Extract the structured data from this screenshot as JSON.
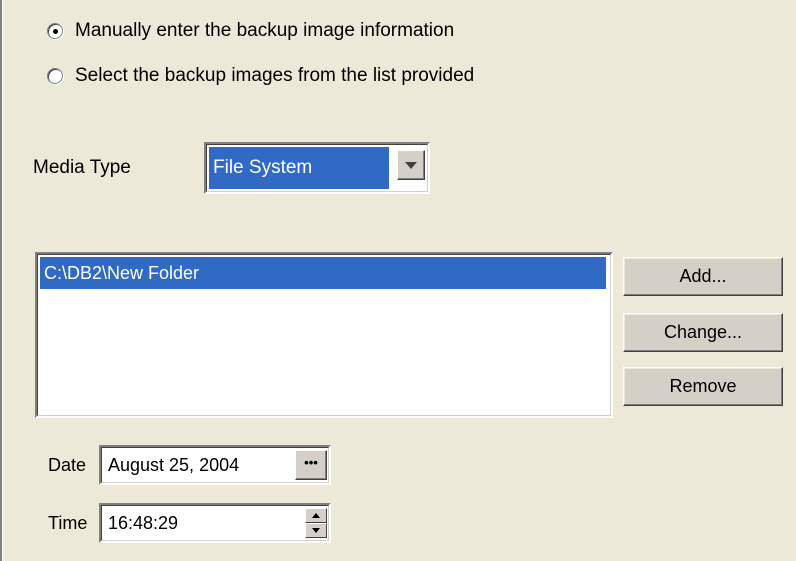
{
  "source": {
    "options": [
      {
        "label": "Manually enter the backup image information",
        "selected": true
      },
      {
        "label": "Select the backup images from the list provided",
        "selected": false
      }
    ]
  },
  "media": {
    "label": "Media Type",
    "selected_value": "File System"
  },
  "locations": {
    "items": [
      "C:\\DB2\\New Folder"
    ],
    "selected_index": 0
  },
  "buttons": {
    "add": "Add...",
    "change": "Change...",
    "remove": "Remove"
  },
  "date": {
    "label": "Date",
    "value": "August 25, 2004",
    "picker_label": "•••"
  },
  "time": {
    "label": "Time",
    "value": "16:48:29"
  },
  "colors": {
    "background": "#ece9d8",
    "selection": "#316ac5"
  }
}
